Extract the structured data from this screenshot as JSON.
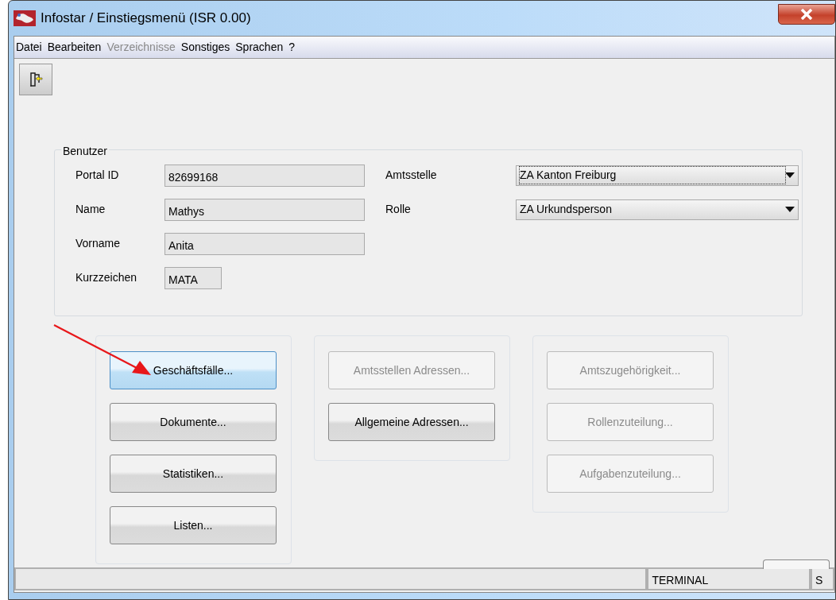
{
  "window": {
    "title": "Infostar / Einstiegsmenü (ISR 0.00)"
  },
  "menu": [
    {
      "label": "Datei",
      "disabled": false
    },
    {
      "label": "Bearbeiten",
      "disabled": false
    },
    {
      "label": "Verzeichnisse",
      "disabled": true
    },
    {
      "label": "Sonstiges",
      "disabled": false
    },
    {
      "label": "Sprachen",
      "disabled": false
    },
    {
      "label": "?",
      "disabled": false
    }
  ],
  "user_group": {
    "title": "Benutzer",
    "fields": [
      {
        "label": "Portal ID",
        "value": "82699168",
        "kind": "wide"
      },
      {
        "label": "Name",
        "value": "Mathys",
        "kind": "wide"
      },
      {
        "label": "Vorname",
        "value": "Anita",
        "kind": "wide"
      },
      {
        "label": "Kurzzeichen",
        "value": "MATA",
        "kind": "short"
      }
    ],
    "selects": [
      {
        "label": "Amtsstelle",
        "value": "ZA Kanton Freiburg",
        "focused": true
      },
      {
        "label": "Rolle",
        "value": "ZA Urkundsperson",
        "focused": false
      }
    ]
  },
  "button_groups": [
    {
      "buttons": [
        {
          "label": "Geschäftsfälle...",
          "disabled": false,
          "highlighted": true
        },
        {
          "label": "Dokumente...",
          "disabled": false,
          "highlighted": false
        },
        {
          "label": "Statistiken...",
          "disabled": false,
          "highlighted": false
        },
        {
          "label": "Listen...",
          "disabled": false,
          "highlighted": false
        }
      ]
    },
    {
      "buttons": [
        {
          "label": "Amtsstellen Adressen...",
          "disabled": true,
          "highlighted": false
        },
        {
          "label": "Allgemeine Adressen...",
          "disabled": false,
          "highlighted": false
        }
      ]
    },
    {
      "buttons": [
        {
          "label": "Amtszugehörigkeit...",
          "disabled": true,
          "highlighted": false
        },
        {
          "label": "Rollenzuteilung...",
          "disabled": true,
          "highlighted": false
        },
        {
          "label": "Aufgabenzuteilung...",
          "disabled": true,
          "highlighted": false
        }
      ]
    }
  ],
  "status_bar": {
    "cells": [
      "",
      "TERMINAL",
      "S"
    ]
  }
}
